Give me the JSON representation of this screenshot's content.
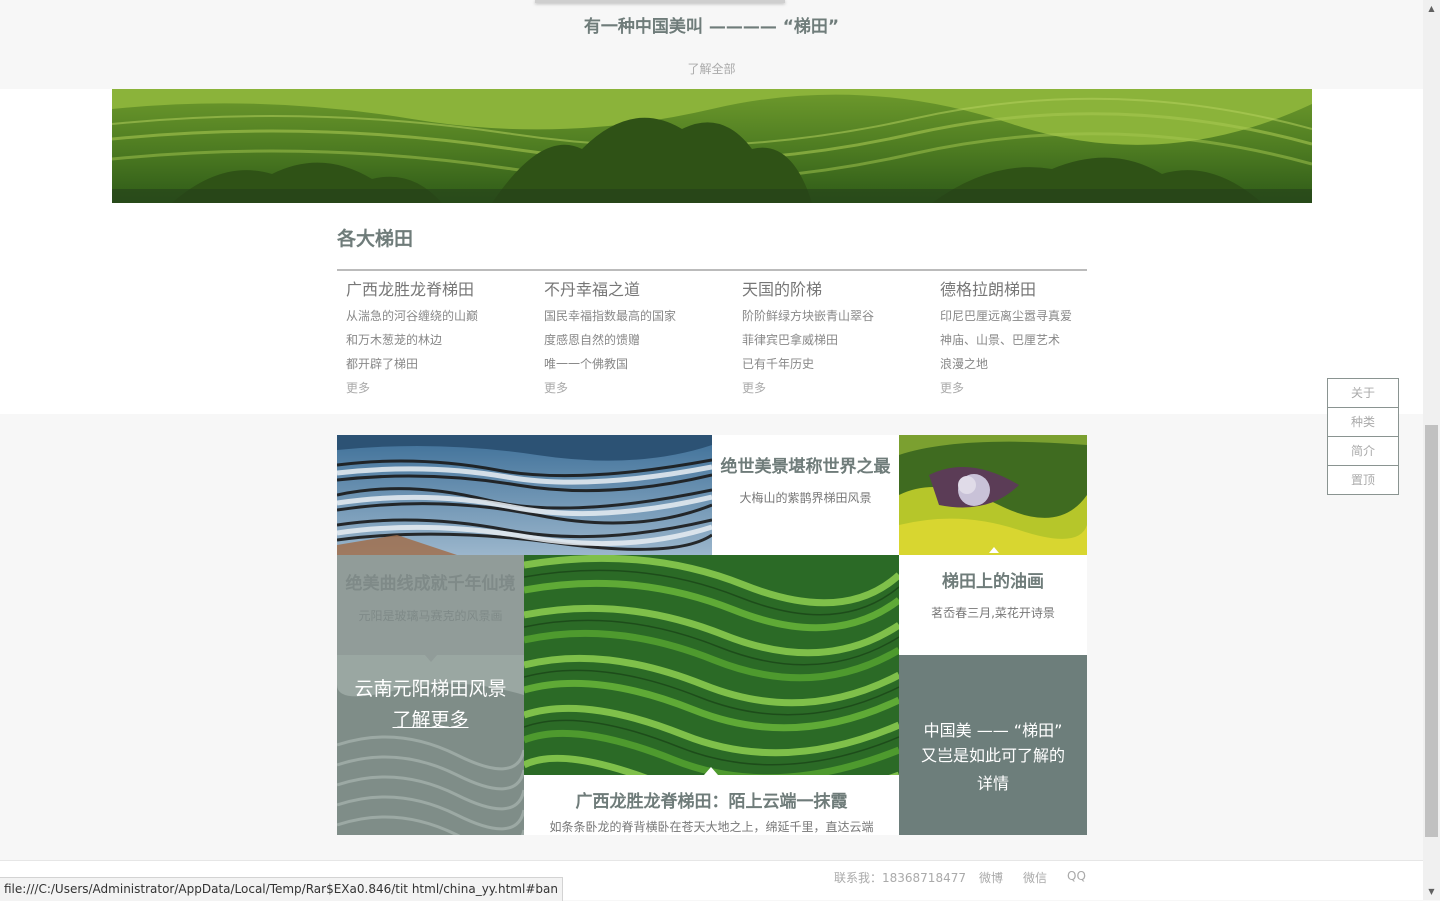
{
  "top": {
    "title": "有一种中国美叫 ———— “梯田”",
    "link": "了解全部"
  },
  "section": {
    "title": "各大梯田"
  },
  "columns": [
    {
      "title": "广西龙胜龙脊梯田",
      "lines": [
        "从湍急的河谷缠绕的山巅",
        "和万木葱茏的林边",
        "都开辟了梯田"
      ],
      "more": "更多"
    },
    {
      "title": "不丹幸福之道",
      "lines": [
        "国民幸福指数最高的国家",
        "度感恩自然的馈赠",
        "唯一一个佛教国"
      ],
      "more": "更多"
    },
    {
      "title": "天国的阶梯",
      "lines": [
        "阶阶鲜绿方块嵌青山翠谷",
        "菲律宾巴拿威梯田",
        "已有千年历史"
      ],
      "more": "更多"
    },
    {
      "title": "德格拉朗梯田",
      "lines": [
        "印尼巴厘远离尘嚣寻真爱",
        "神庙、山景、巴厘艺术",
        "浪漫之地"
      ],
      "more": "更多"
    }
  ],
  "mosaic": {
    "best": {
      "title": "绝世美景堪称世界之最",
      "sub": "大梅山的紫鹊界梯田风景"
    },
    "oil": {
      "title": "梯田上的油画",
      "sub": "茗岙春三月,菜花开诗景"
    },
    "faded": {
      "title": "绝美曲线成就千年仙境",
      "sub": "元阳是玻璃马赛克的风景画"
    },
    "yuanyang": {
      "title": "云南元阳梯田风景",
      "link": "了解更多"
    },
    "longsheng": {
      "title": "广西龙胜龙脊梯田：陌上云端一抹霞",
      "sub": "如条条卧龙的脊背横卧在苍天大地之上，绵延千里，直达云端"
    },
    "dark": {
      "line1": "中国美 —— “梯田”",
      "line2": "又岂是如此可了解的",
      "line3": "详情"
    }
  },
  "side_nav": [
    "关于",
    "种类",
    "简介",
    "置顶"
  ],
  "footer": {
    "contact": "联系我：18368718477",
    "weibo": "微博",
    "weixin": "微信",
    "qq": "QQ"
  },
  "status_bar": "file:///C:/Users/Administrator/AppData/Local/Temp/Rar$EXa0.846/tit html/china_yy.html#ban",
  "colors": {
    "accent": "#6d7e7b",
    "title": "#6f7c7a",
    "faded": "#919c99"
  }
}
